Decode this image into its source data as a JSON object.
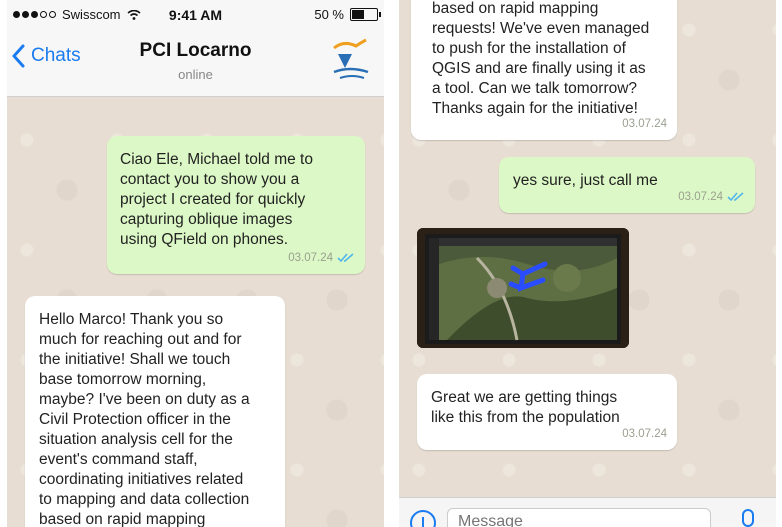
{
  "status": {
    "carrier": "Swisscom",
    "time": "9:41 AM",
    "battery_text": "50 %",
    "battery_level": 0.5
  },
  "header": {
    "back_label": "Chats",
    "title": "PCI Locarno",
    "subtitle": "online"
  },
  "left_messages": [
    {
      "direction": "out",
      "text": "Ciao Ele, Michael told me to\ncontact you to show you a\nproject I created for quickly\ncapturing oblique images\nusing QField on phones.",
      "time": "03.07.24"
    },
    {
      "direction": "in",
      "text": "Hello Marco! Thank you so\nmuch for reaching out and for\nthe initiative! Shall we touch\nbase tomorrow morning,\nmaybe? I've been on duty as a\nCivil Protection officer in the\nsituation analysis cell for the\nevent's command staff,\ncoordinating initiatives related\nto mapping and data collection\nbased on rapid mapping"
    }
  ],
  "right_messages": [
    {
      "direction": "in",
      "text": "based on rapid mapping\nrequests! We've even managed\nto push for the installation of\nQGIS and are finally using it as\na tool. Can we talk tomorrow?\nThanks again for the initiative!",
      "time": "03.07.24"
    },
    {
      "direction": "out",
      "text": "yes sure, just call me",
      "time": "03.07.24"
    },
    {
      "direction": "in",
      "text": "Great we are getting things\nlike this from the population",
      "time": "03.07.24"
    }
  ],
  "input": {
    "placeholder": "Message"
  },
  "icons": {
    "back": "chevron-left-icon",
    "wifi": "wifi-icon",
    "battery": "battery-icon",
    "read": "double-check-icon",
    "attach": "upload-icon",
    "mic": "microphone-icon"
  },
  "colors": {
    "accent": "#1a7cf0",
    "outgoing": "#dcf8c6",
    "incoming": "#ffffff",
    "read_ticks": "#4fb6ec"
  }
}
